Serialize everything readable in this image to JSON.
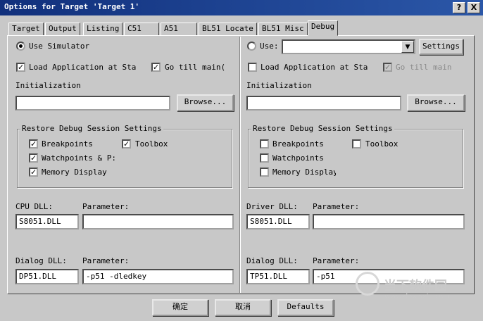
{
  "window": {
    "title": "Options for Target 'Target 1'",
    "help_btn": "?",
    "close_btn": "X"
  },
  "tabs": [
    "Target",
    "Output",
    "Listing",
    "C51",
    "A51",
    "BL51 Locate",
    "BL51 Misc",
    "Debug"
  ],
  "left": {
    "use_simulator": "Use Simulator",
    "load_app": "Load Application at Sta",
    "go_till_main": "Go  till main(",
    "initialization": "Initialization",
    "browse": "Browse...",
    "restore_legend": "Restore Debug Session Settings",
    "breakpoints": "Breakpoints",
    "toolbox": "Toolbox",
    "watchpoints": "Watchpoints & P:",
    "memory_display": "Memory Display",
    "cpu_dll_label": "CPU DLL:",
    "cpu_param_label": "Parameter:",
    "cpu_dll_value": "S8051.DLL",
    "cpu_param_value": "",
    "dialog_dll_label": "Dialog DLL:",
    "dialog_param_label": "Parameter:",
    "dialog_dll_value": "DP51.DLL",
    "dialog_param_value": "-p51 -dledkey"
  },
  "right": {
    "use": "Use:",
    "use_select_value": "",
    "settings": "Settings",
    "load_app": "Load Application at Sta",
    "go_till_main": "Go  till main",
    "initialization": "Initialization",
    "browse": "Browse...",
    "restore_legend": "Restore Debug Session Settings",
    "breakpoints": "Breakpoints",
    "toolbox": "Toolbox",
    "watchpoints": "Watchpoints",
    "memory_display": "Memory Display",
    "driver_dll_label": "Driver DLL:",
    "driver_param_label": "Parameter:",
    "driver_dll_value": "S8051.DLL",
    "driver_param_value": "",
    "dialog_dll_label": "Dialog DLL:",
    "dialog_param_label": "Parameter:",
    "dialog_dll_value": "TP51.DLL",
    "dialog_param_value": "-p51"
  },
  "buttons": {
    "ok": "确定",
    "cancel": "取消",
    "defaults": "Defaults"
  },
  "watermark": {
    "name": "当下软件园",
    "url": "www.downxia.com"
  }
}
